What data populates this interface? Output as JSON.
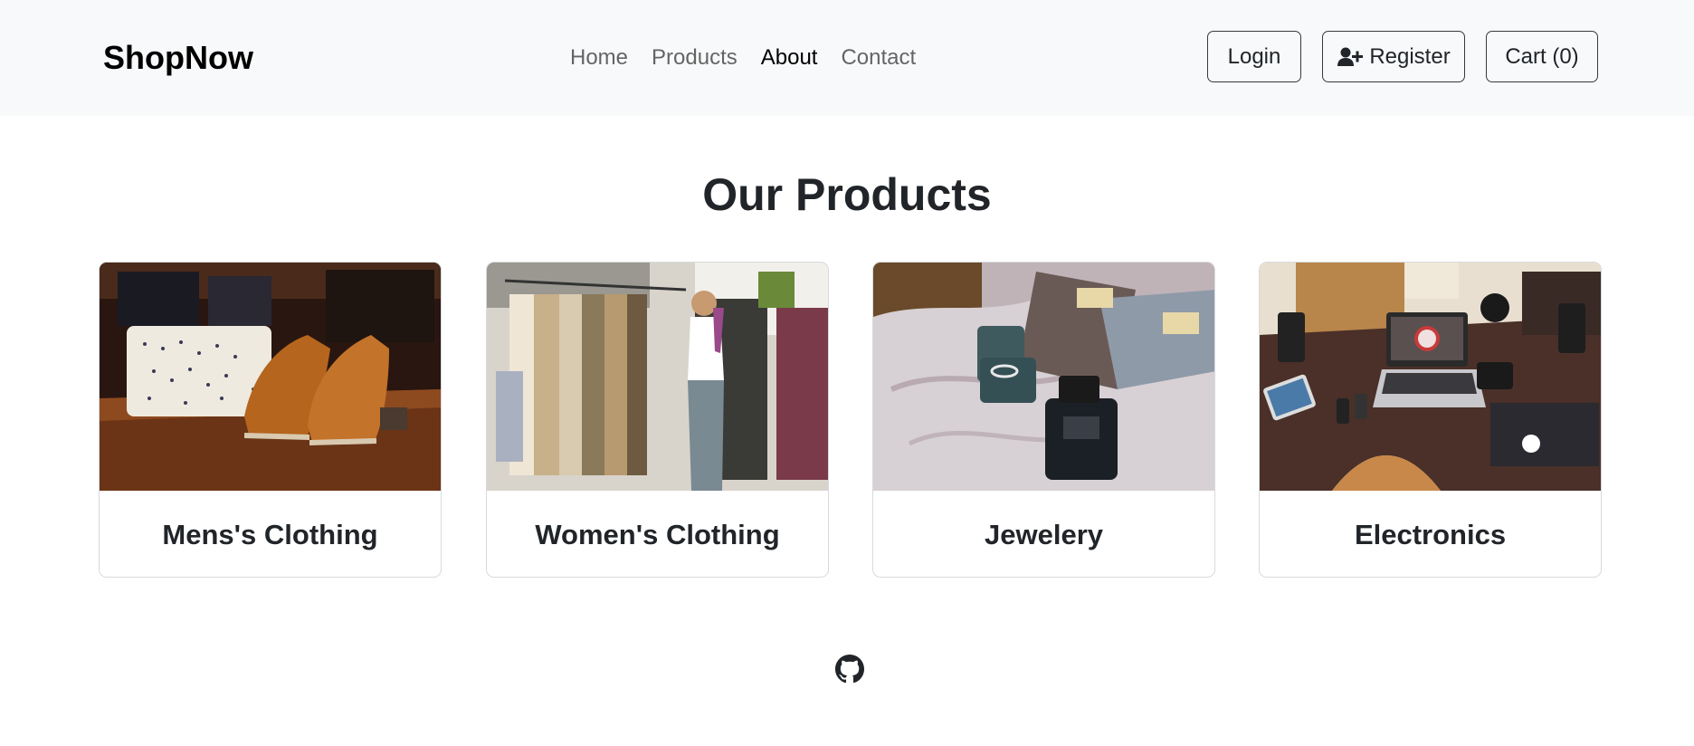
{
  "navbar": {
    "brand": "ShopNow",
    "links": [
      {
        "label": "Home",
        "active": false
      },
      {
        "label": "Products",
        "active": false
      },
      {
        "label": "About",
        "active": true
      },
      {
        "label": "Contact",
        "active": false
      }
    ],
    "login_label": "Login",
    "register_label": "Register",
    "cart_label": "Cart (0)",
    "register_icon": "user-plus-icon"
  },
  "main": {
    "title": "Our Products",
    "categories": [
      {
        "label": "Mens's Clothing",
        "image": "shirt-and-shoes-photo"
      },
      {
        "label": "Women's Clothing",
        "image": "clothing-rack-photo"
      },
      {
        "label": "Jewelery",
        "image": "ring-and-perfume-photo"
      },
      {
        "label": "Electronics",
        "image": "laptop-desk-photo"
      }
    ]
  },
  "footer": {
    "icon": "github-icon"
  },
  "colors": {
    "navbar_bg": "#f8f9fa",
    "text": "#212529",
    "muted_link": "rgba(0,0,0,0.6)",
    "border": "#d7dadd"
  }
}
